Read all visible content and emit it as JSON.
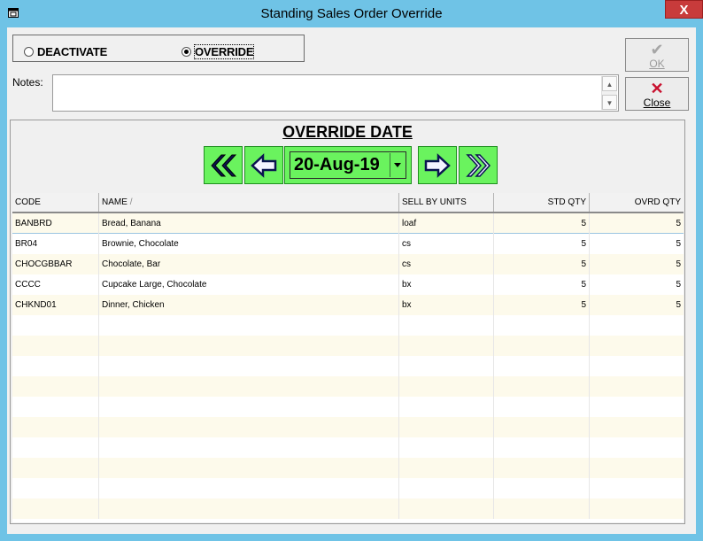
{
  "window": {
    "title": "Standing Sales Order Override",
    "close_glyph": "X"
  },
  "mode": {
    "options": [
      {
        "label": "DEACTIVATE",
        "selected": false
      },
      {
        "label": "OVERRIDE",
        "selected": true
      }
    ]
  },
  "notes": {
    "label": "Notes:",
    "value": ""
  },
  "buttons": {
    "ok": "OK",
    "close": "Close"
  },
  "override": {
    "title": "OVERRIDE DATE",
    "date": "20-Aug-19",
    "nav_icons": [
      "first-icon",
      "previous-icon",
      "next-icon",
      "last-icon"
    ]
  },
  "grid": {
    "columns": [
      "CODE",
      "NAME",
      "SELL BY UNITS",
      "STD QTY",
      "OVRD QTY"
    ],
    "sort_indicator": "/",
    "rows": [
      {
        "code": "BANBRD",
        "name": "Bread, Banana",
        "unit": "loaf",
        "std": "5",
        "ovrd": "5"
      },
      {
        "code": "BR04",
        "name": "Brownie, Chocolate",
        "unit": "cs",
        "std": "5",
        "ovrd": "5"
      },
      {
        "code": "CHOCGBBAR",
        "name": "Chocolate, Bar",
        "unit": "cs",
        "std": "5",
        "ovrd": "5"
      },
      {
        "code": "CCCC",
        "name": "Cupcake Large, Chocolate",
        "unit": "bx",
        "std": "5",
        "ovrd": "5"
      },
      {
        "code": "CHKND01",
        "name": "Dinner, Chicken",
        "unit": "bx",
        "std": "5",
        "ovrd": "5"
      }
    ]
  },
  "colors": {
    "accent_green": "#6af35e",
    "title_bar": "#6fc3e6",
    "row_alt": "#fdfaeb",
    "close_red": "#c83b3b"
  }
}
